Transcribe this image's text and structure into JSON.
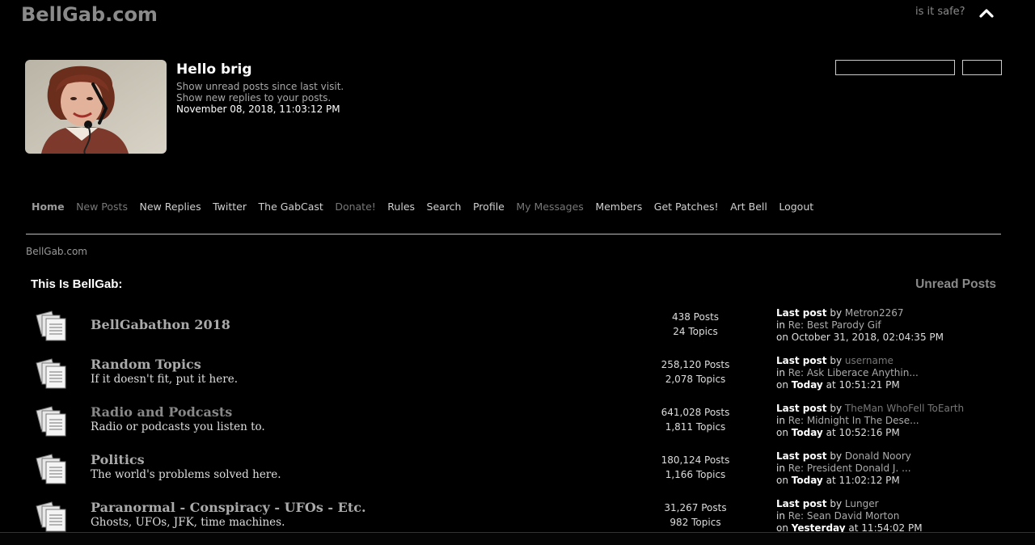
{
  "header": {
    "site_title": "BellGab.com",
    "tagline": "is it safe?",
    "collapse_icon": "chevron-up-icon"
  },
  "user": {
    "greeting": "Hello brig",
    "unread_link": "Show unread posts since last visit.",
    "replies_link": "Show new replies to your posts.",
    "datetime": "November 08, 2018, 11:03:12 PM"
  },
  "search": {
    "value": "",
    "button_label": ""
  },
  "nav": [
    {
      "label": "Home"
    },
    {
      "label": "New Posts"
    },
    {
      "label": "New Replies"
    },
    {
      "label": "Twitter"
    },
    {
      "label": "The GabCast"
    },
    {
      "label": "Donate!"
    },
    {
      "label": "Rules"
    },
    {
      "label": "Search"
    },
    {
      "label": "Profile"
    },
    {
      "label": "My Messages"
    },
    {
      "label": "Members"
    },
    {
      "label": "Get Patches!"
    },
    {
      "label": "Art Bell"
    },
    {
      "label": "Logout"
    }
  ],
  "breadcrumb": "BellGab.com",
  "category": {
    "title": "This Is BellGab:",
    "unread_label": "Unread Posts"
  },
  "boards": [
    {
      "name": "BellGabathon 2018",
      "description": "",
      "posts": "438 Posts",
      "topics": "24 Topics",
      "last_label": "Last post",
      "by": "by",
      "author": "Metron2267",
      "in": "in",
      "topic": "Re: Best Parody Gif",
      "on": "on",
      "when_bold": "",
      "when": "October 31, 2018, 02:04:35 PM"
    },
    {
      "name": "Random Topics",
      "description": "If it doesn't fit, put it here.",
      "posts": "258,120 Posts",
      "topics": "2,078 Topics",
      "last_label": "Last post",
      "by": "by",
      "author": "username",
      "in": "in",
      "topic": "Re: Ask Liberace Anythin...",
      "on": "on",
      "when_bold": "Today",
      "when": "at 10:51:21 PM"
    },
    {
      "name": "Radio and Podcasts",
      "description": "Radio or podcasts you listen to.",
      "posts": "641,028 Posts",
      "topics": "1,811 Topics",
      "last_label": "Last post",
      "by": "by",
      "author": "TheMan WhoFell ToEarth",
      "in": "in",
      "topic": "Re: Midnight In The Dese...",
      "on": "on",
      "when_bold": "Today",
      "when": "at 10:52:16 PM"
    },
    {
      "name": "Politics",
      "description": "The world's problems solved here.",
      "posts": "180,124 Posts",
      "topics": "1,166 Topics",
      "last_label": "Last post",
      "by": "by",
      "author": "Donald Noory",
      "in": "in",
      "topic": "Re: President Donald J. ...",
      "on": "on",
      "when_bold": "Today",
      "when": "at 11:02:12 PM"
    },
    {
      "name": "Paranormal - Conspiracy - UFOs - Etc.",
      "description": "Ghosts, UFOs, JFK, time machines.",
      "posts": "31,267 Posts",
      "topics": "982 Topics",
      "last_label": "Last post",
      "by": "by",
      "author": "Lunger",
      "in": "in",
      "topic": "Re: Sean David Morton",
      "on": "on",
      "when_bold": "Yesterday",
      "when": "at 11:54:02 PM"
    }
  ],
  "icons": {
    "board": "board-papers-icon",
    "avatar": "avatar-image"
  },
  "colors": {
    "background": "#000000",
    "dim_text": "#8a8a8a",
    "text": "#dddddd"
  }
}
